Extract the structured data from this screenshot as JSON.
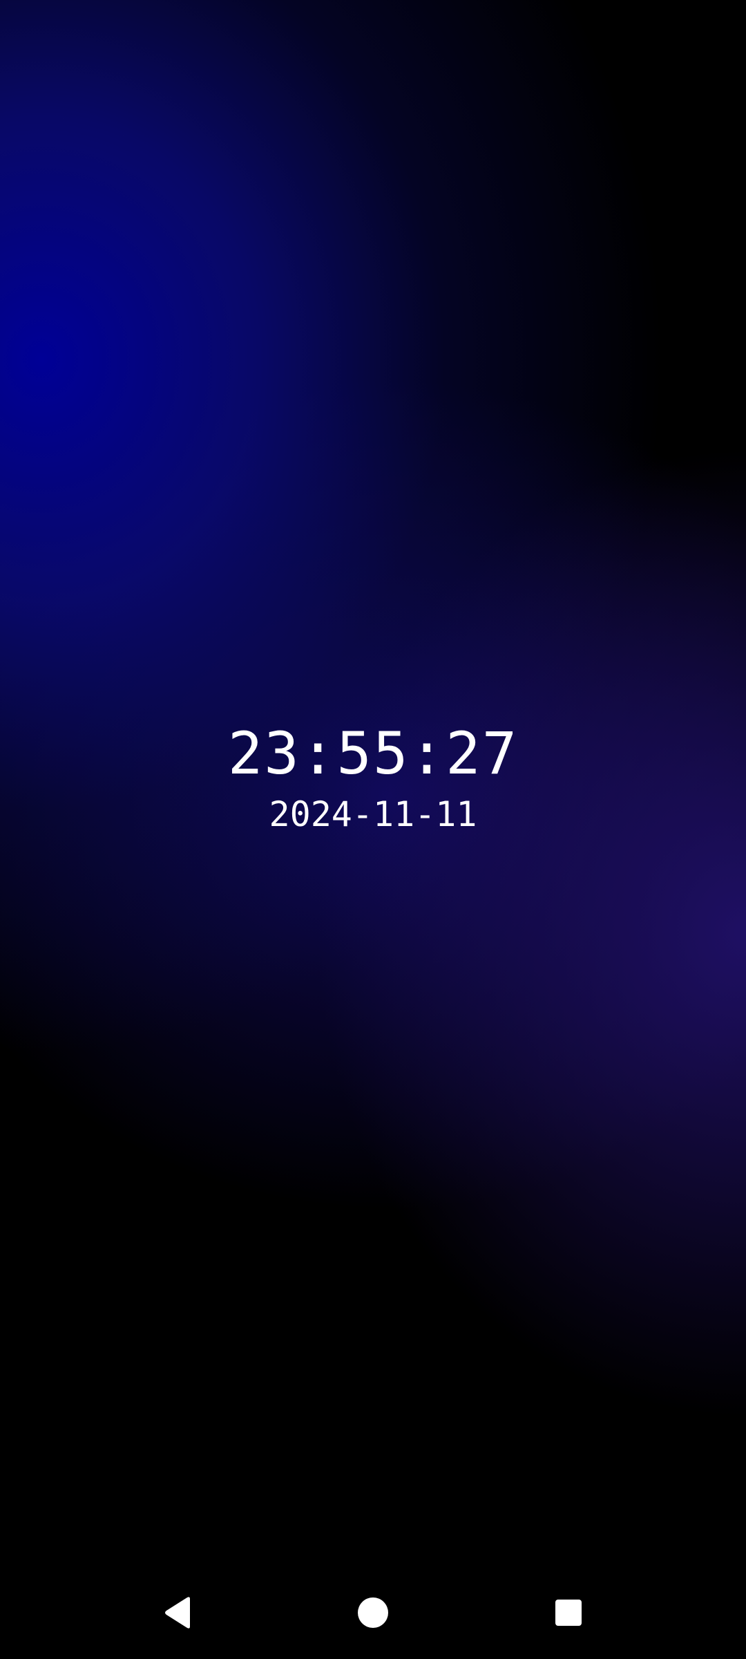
{
  "clock": {
    "time": "23:55:27",
    "date": "2024-11-11"
  },
  "nav": {
    "back_icon": "back-triangle-icon",
    "home_icon": "home-circle-icon",
    "recents_icon": "recents-square-icon"
  },
  "colors": {
    "text": "#ffffff",
    "background_accent_blue": "#000096",
    "background_accent_purple": "#201068",
    "nav_icon": "#ffffff"
  }
}
